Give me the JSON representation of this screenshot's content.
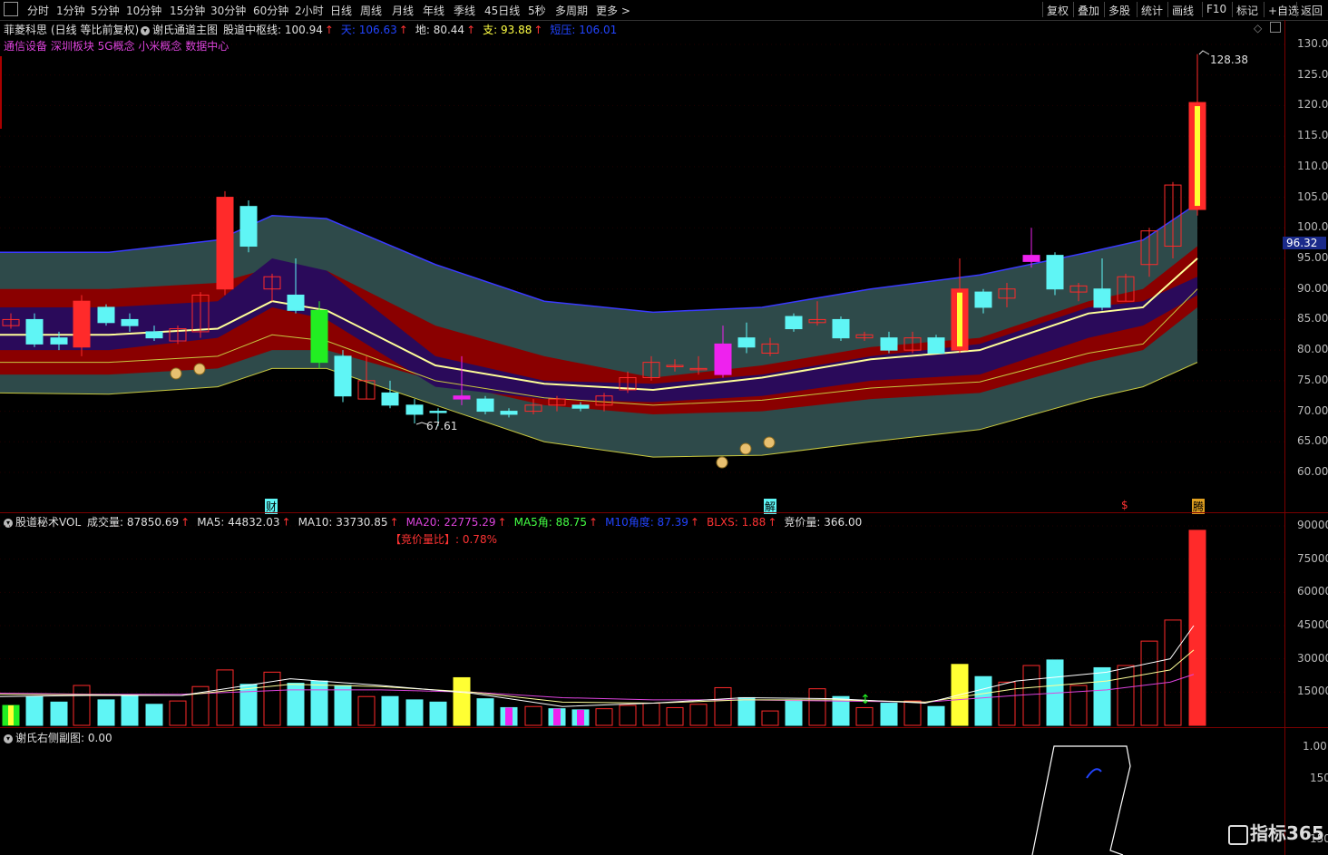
{
  "toolbar": {
    "left_items": [
      "分时",
      "1分钟",
      "5分钟",
      "10分钟",
      "15分钟",
      "30分钟",
      "60分钟",
      "2小时",
      "日线",
      "周线",
      "月线",
      "年线",
      "季线",
      "45日线",
      "5秒",
      "多周期",
      "更多"
    ],
    "right_items": [
      "复权",
      "叠加",
      "多股",
      "统计",
      "画线",
      "F10",
      "标记",
      "+自选",
      "返回"
    ]
  },
  "stock": {
    "name": "菲菱科思",
    "mode": "(日线 等比前复权)",
    "indicator": "谢氏通道主图",
    "concepts": "通信设备 深圳板块 5G概念 小米概念 数据中心"
  },
  "main_indicators": [
    {
      "label": "股道中枢线: 100.94",
      "color": "#e0e0e0"
    },
    {
      "label": "天: 106.63",
      "color": "#2244ff"
    },
    {
      "label": "地: 80.44",
      "color": "#e0e0e0"
    },
    {
      "label": "支: 93.88",
      "color": "#ffff44"
    },
    {
      "label": "短压: 106.01",
      "color": "#2244ff"
    }
  ],
  "price_axis": {
    "ticks": [
      "130.00",
      "125.00",
      "120.00",
      "115.00",
      "110.00",
      "105.00",
      "100.00",
      "95.00",
      "90.00",
      "85.00",
      "80.00",
      "75.00",
      "70.00",
      "65.00",
      "60.00"
    ],
    "current_price": "96.32"
  },
  "annotations": {
    "high_label": "128.38",
    "low_label": "67.61",
    "event_cai": "财",
    "event_jie": "解",
    "event_s": "$",
    "event_last": "腾"
  },
  "vol_panel": {
    "title": "股道秘术VOL",
    "indicators": [
      {
        "label": "成交量: 87850.69",
        "color": "#e0e0e0"
      },
      {
        "label": "MA5: 44832.03",
        "color": "#e0e0e0"
      },
      {
        "label": "MA10: 33730.85",
        "color": "#e0e0e0"
      },
      {
        "label": "MA20: 22775.29",
        "color": "#dd44dd"
      },
      {
        "label": "MA5角: 88.75",
        "color": "#44ff44"
      },
      {
        "label": "M10角度: 87.39",
        "color": "#2244ff"
      },
      {
        "label": "BLXS: 1.88",
        "color": "#ff3333"
      },
      {
        "label": "竞价量: 366.00",
        "color": "#e0e0e0"
      }
    ],
    "ratio_label": "【竞价量比】: 0.78%",
    "ticks": [
      "90000",
      "75000",
      "60000",
      "45000",
      "30000",
      "15000"
    ]
  },
  "side_panel": {
    "title": "谢氏右侧副图",
    "value": ": 0.00",
    "ticks": [
      "1.00",
      "150",
      "150"
    ]
  },
  "watermark": "指标365",
  "colors": {
    "up": "#ff2a2a",
    "down": "#5ff5f5",
    "outer_band": "#2e4a4a",
    "mid_band": "#8a0000",
    "inner_band": "#2a0a5a",
    "center_line": "#ffff99"
  }
}
